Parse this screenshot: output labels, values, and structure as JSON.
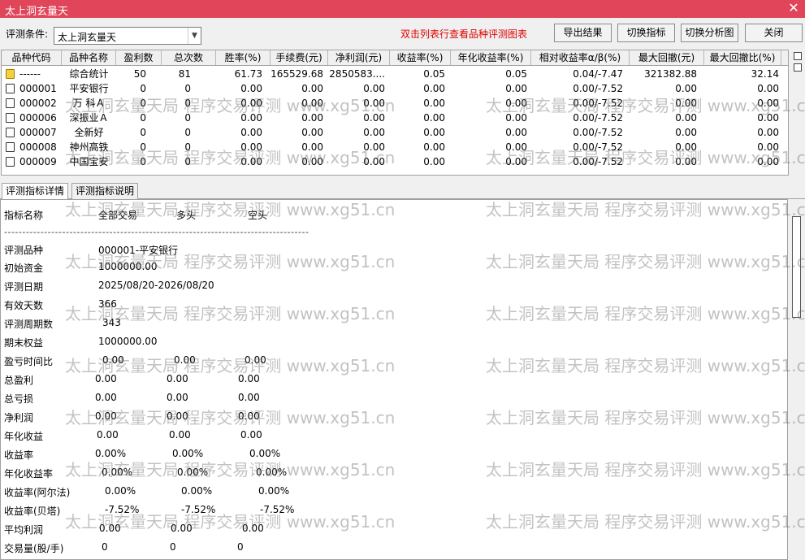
{
  "window": {
    "title": "太上洞玄量天",
    "close_icon": "close-icon"
  },
  "toolbar": {
    "condition_label": "评测条件:",
    "condition_value": "太上洞玄量天",
    "hint": "双击列表行查看品种评测图表",
    "hint_color": "#e00000",
    "buttons": [
      "导出结果",
      "切换指标",
      "切换分析图",
      "关闭"
    ]
  },
  "grid": {
    "columns": [
      "品种代码",
      "品种名称",
      "盈利数",
      "总次数",
      "胜率(%)",
      "手续费(元)",
      "净利润(元)",
      "收益率(%)",
      "年化收益率(%)",
      "相对收益率α/β(%)",
      "最大回撤(元)",
      "最大回撤比(%)"
    ],
    "rows": [
      {
        "code": "------",
        "name": "综合统计",
        "icon": "summary-folder-icon",
        "cells": [
          "50",
          "81",
          "61.73",
          "165529.68",
          "2850583....",
          "0.05",
          "0.05",
          "0.04/-7.47",
          "321382.88",
          "32.14"
        ]
      },
      {
        "code": "000001",
        "name": "平安银行",
        "icon": "document-icon",
        "cells": [
          "0",
          "0",
          "0.00",
          "0.00",
          "0.00",
          "0.00",
          "0.00",
          "0.00/-7.52",
          "0.00",
          "0.00"
        ]
      },
      {
        "code": "000002",
        "name": "万 科Ａ",
        "icon": "document-icon",
        "cells": [
          "0",
          "0",
          "0.00",
          "0.00",
          "0.00",
          "0.00",
          "0.00",
          "0.00/-7.52",
          "0.00",
          "0.00"
        ]
      },
      {
        "code": "000006",
        "name": "深振业Ａ",
        "icon": "document-icon",
        "cells": [
          "0",
          "0",
          "0.00",
          "0.00",
          "0.00",
          "0.00",
          "0.00",
          "0.00/-7.52",
          "0.00",
          "0.00"
        ]
      },
      {
        "code": "000007",
        "name": "全新好",
        "icon": "document-icon",
        "cells": [
          "0",
          "0",
          "0.00",
          "0.00",
          "0.00",
          "0.00",
          "0.00",
          "0.00/-7.52",
          "0.00",
          "0.00"
        ]
      },
      {
        "code": "000008",
        "name": "神州高铁",
        "icon": "document-icon",
        "cells": [
          "0",
          "0",
          "0.00",
          "0.00",
          "0.00",
          "0.00",
          "0.00",
          "0.00/-7.52",
          "0.00",
          "0.00"
        ]
      },
      {
        "code": "000009",
        "name": "中国宝安",
        "icon": "document-icon",
        "cells": [
          "0",
          "0",
          "0.00",
          "0.00",
          "0.00",
          "0.00",
          "0.00",
          "0.00/-7.52",
          "0.00",
          "0.00"
        ]
      }
    ]
  },
  "tabs": [
    "评测指标详情",
    "评测指标说明"
  ],
  "details": {
    "headers": [
      "指标名称",
      "全部交易",
      "多头",
      "空头"
    ],
    "divider": "------------------------------------------------------------------------------------",
    "rows": [
      {
        "label": "评测品种",
        "values": [
          "000001-平安银行"
        ]
      },
      {
        "label": "初始资金",
        "values": [
          "1000000.00"
        ]
      },
      {
        "label": "评测日期",
        "values": [
          "2025/08/20-2026/08/20"
        ]
      },
      {
        "label": "有效天数",
        "values": [
          "366"
        ]
      },
      {
        "label": "评测周期数",
        "values": [
          "343"
        ]
      },
      {
        "label": "期末权益",
        "values": [
          "1000000.00"
        ]
      },
      {
        "label": "盈亏时间比",
        "values": [
          "0.00",
          "0.00",
          "0.00"
        ]
      },
      {
        "label": "总盈利",
        "values": [
          "0.00",
          "0.00",
          "0.00"
        ]
      },
      {
        "label": "总亏损",
        "values": [
          "0.00",
          "0.00",
          "0.00"
        ]
      },
      {
        "label": "净利润",
        "values": [
          "0.00",
          "0.00",
          "0.00"
        ]
      },
      {
        "label": "年化收益",
        "values": [
          "0.00",
          "0.00",
          "0.00"
        ]
      },
      {
        "label": "收益率",
        "values": [
          "0.00%",
          "0.00%",
          "0.00%"
        ]
      },
      {
        "label": "年化收益率",
        "values": [
          "0.00%",
          "0.00%",
          "0.00%"
        ]
      },
      {
        "label": "收益率(阿尔法)",
        "values": [
          "0.00%",
          "0.00%",
          "0.00%"
        ]
      },
      {
        "label": "收益率(贝塔)",
        "values": [
          "-7.52%",
          "-7.52%",
          "-7.52%"
        ]
      },
      {
        "label": "平均利润",
        "values": [
          "0.00",
          "0.00",
          "0.00"
        ]
      },
      {
        "label": "交易量(股/手)",
        "values": [
          "0",
          "0",
          "0"
        ]
      }
    ]
  },
  "watermark": {
    "text": "太上洞玄量天局 程序交易评测 www.xg51.cn"
  }
}
